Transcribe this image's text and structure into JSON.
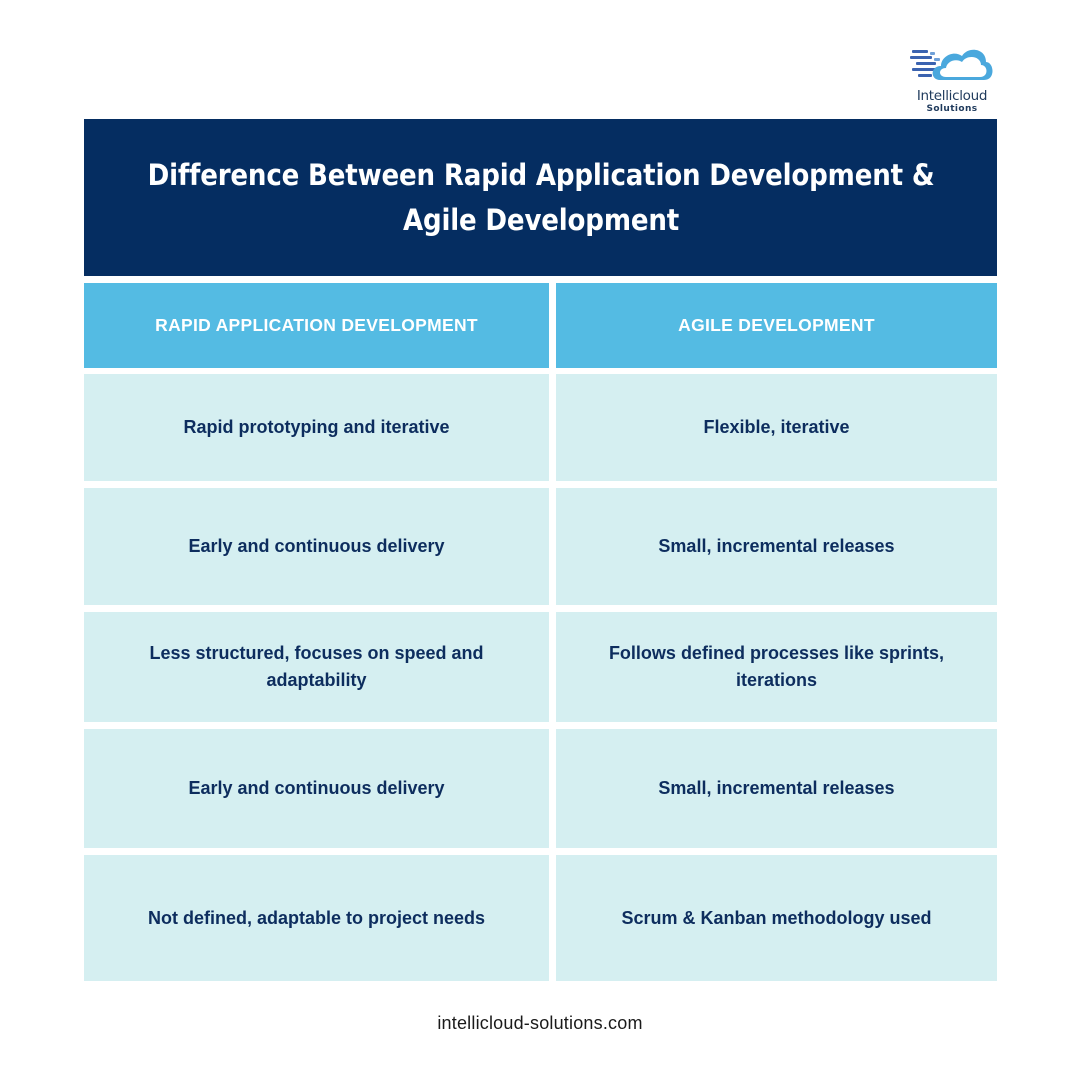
{
  "brand": {
    "name": "Intellicloud",
    "subtitle": "Solutions",
    "colors": {
      "title_bg": "#052d61",
      "header_bg": "#54bbe3",
      "cell_bg": "#d5eff1",
      "cell_text": "#0d2d5e",
      "logo_cloud": "#4aa8dd"
    }
  },
  "title": "Difference Between Rapid Application Development & Agile Development",
  "table": {
    "headers": [
      "RAPID APPLICATION DEVELOPMENT",
      "AGILE DEVELOPMENT"
    ],
    "rows": [
      [
        "Rapid prototyping and iterative",
        "Flexible, iterative"
      ],
      [
        "Early and continuous delivery",
        "Small, incremental releases"
      ],
      [
        "Less structured, focuses on speed and adaptability",
        "Follows defined processes like sprints, iterations"
      ],
      [
        "Early and continuous delivery",
        "Small, incremental releases"
      ],
      [
        "Not defined, adaptable to project needs",
        "Scrum & Kanban methodology used"
      ]
    ]
  },
  "footer": "intellicloud-solutions.com"
}
